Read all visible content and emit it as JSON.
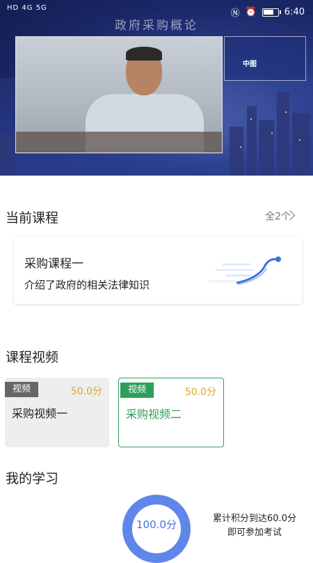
{
  "status_bar": {
    "network_left": "HD 4G 5G",
    "time": "6:40"
  },
  "video": {
    "title": "政府采购概论",
    "mini_label": "中图"
  },
  "current_course": {
    "heading": "当前课程",
    "more_label": "全2个",
    "card": {
      "title": "采购课程一",
      "description": "介绍了政府的相关法律知识"
    }
  },
  "course_videos": {
    "heading": "课程视频",
    "items": [
      {
        "tag": "视频",
        "score": "50.0分",
        "name": "采购视频一",
        "selected": false
      },
      {
        "tag": "视频",
        "score": "50.0分",
        "name": "采购视频二",
        "selected": true
      }
    ]
  },
  "my_study": {
    "heading": "我的学习",
    "total_score": "100.0分",
    "hint_line1": "累计积分到达60.0分",
    "hint_line2": "即可参加考试"
  },
  "colors": {
    "accent_green": "#2e9e5a",
    "score_gold": "#e0a826",
    "ring_blue": "#5f86ea"
  },
  "battery_level": 0.8
}
